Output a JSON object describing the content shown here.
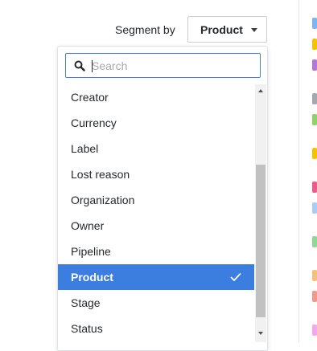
{
  "segment": {
    "label": "Segment by",
    "selected": "Product"
  },
  "search": {
    "placeholder": "Search",
    "value": ""
  },
  "options": [
    "Creator",
    "Currency",
    "Label",
    "Lost reason",
    "Organization",
    "Owner",
    "Pipeline",
    "Product",
    "Stage",
    "Status"
  ],
  "selected_option": "Product",
  "colors": {
    "accent": "#3b7ee0",
    "legend_swatches": [
      "#7bb6f0",
      "#f2c300",
      "#b079d6",
      "#a3a8ad",
      "#8fd26b",
      "#f2c300",
      "#ef5a8c",
      "#a9cdf4",
      "#8fd89a",
      "#f5c07a",
      "#f09a8a",
      "#f3a8f0"
    ]
  }
}
